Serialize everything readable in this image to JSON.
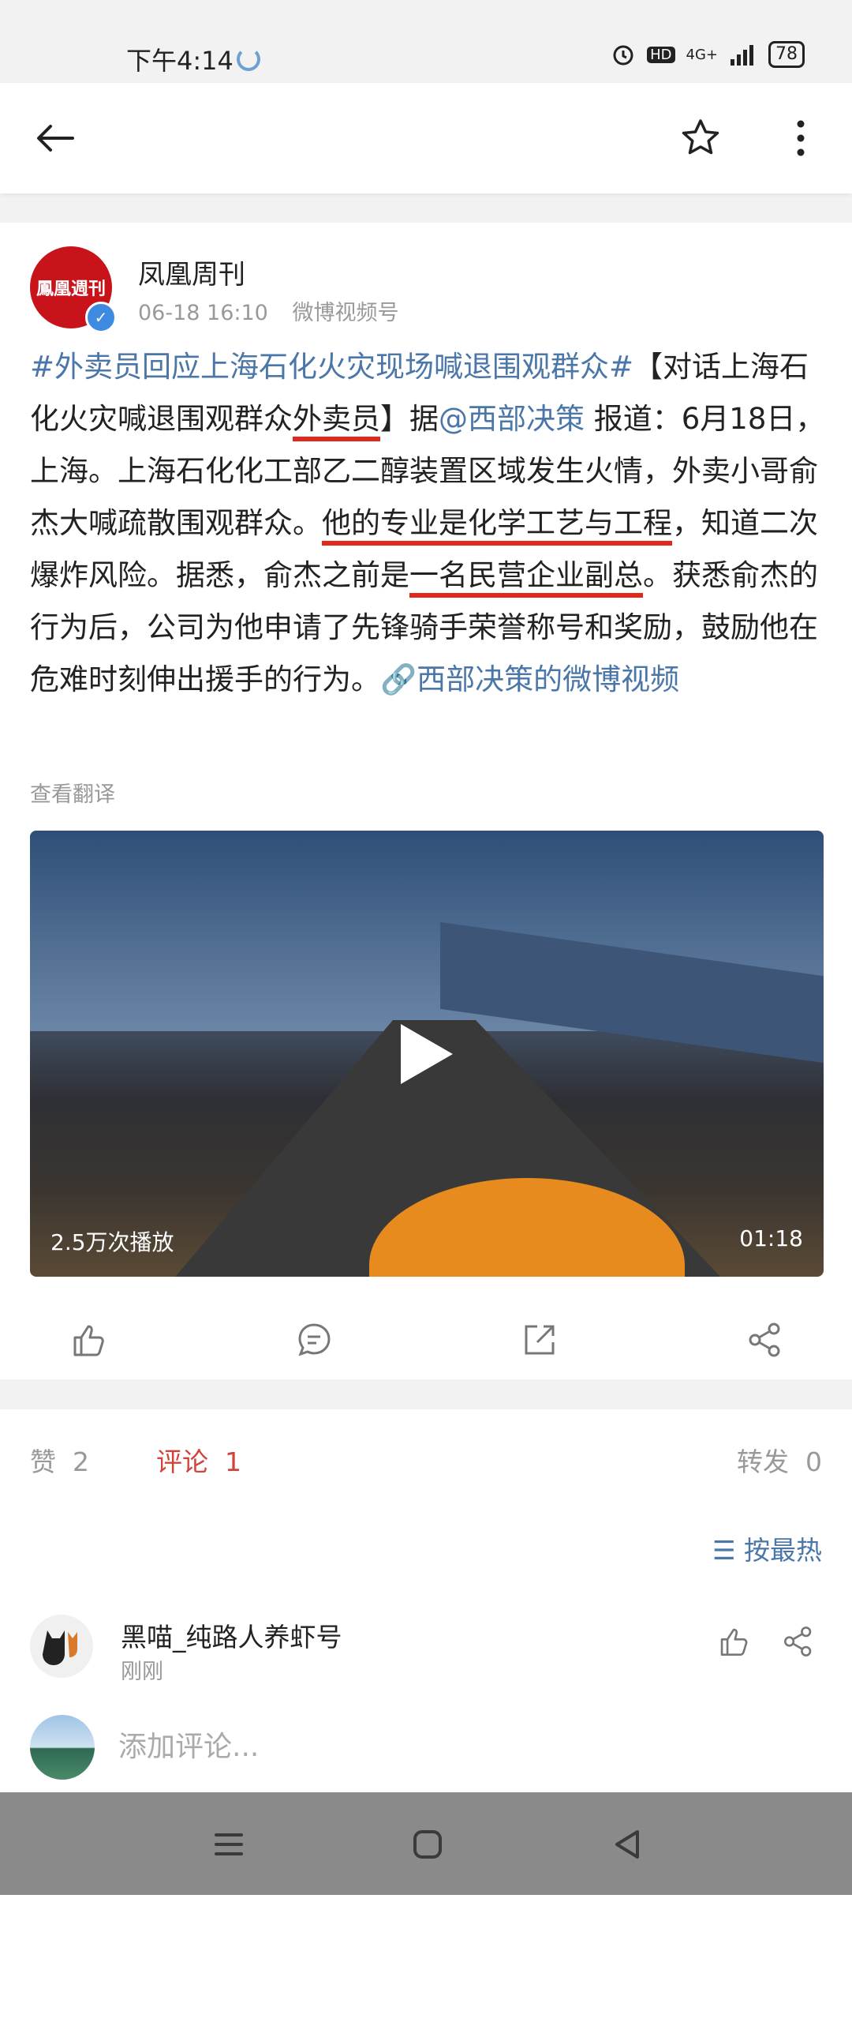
{
  "status_bar": {
    "time": "下午4:14",
    "network": "4G+",
    "hd": "HD",
    "battery": "78"
  },
  "header": {
    "back": "back",
    "star": "favorite",
    "more": "more"
  },
  "post": {
    "author": "凤凰周刊",
    "avatar_text": "鳳凰週刊",
    "timestamp": "06-18 16:10",
    "source": "微博视频号",
    "topic": "#外卖员回应上海石化火灾现场喊退围观群众#",
    "text_a": "【对话上海石化火灾喊退围观群众",
    "text_ul1": "外卖员",
    "text_b": "】据",
    "mention": "@西部决策",
    "text_c": " 报道：6月18日，上海。上海石化化工部乙二醇装置区域发生火情，外卖小哥俞杰大喊疏散围观群众。",
    "text_ul2": "他的专业是化学工艺与工程",
    "text_d": "，知道二次爆炸风险。据悉，俞杰之前是",
    "text_ul3": "一名民营企业副总",
    "text_e": "。获悉俞杰的行为后，公司为他申请了先锋骑手荣誉称号和奖励，鼓励他在危难时刻伸出援手的行为。",
    "video_link": "西部决策的微博视频",
    "translate": "查看翻译",
    "video": {
      "plays": "2.5万次播放",
      "duration": "01:18"
    }
  },
  "stats": {
    "likes_label": "赞",
    "likes": "2",
    "comments_label": "评论",
    "comments": "1",
    "shares_label": "转发",
    "shares": "0",
    "sort": "按最热"
  },
  "comment": {
    "name": "黑喵_纯路人养虾号",
    "time": "刚刚"
  },
  "comment_input": {
    "placeholder": "添加评论..."
  },
  "colors": {
    "link": "#4a76a8",
    "accent": "#d0443a",
    "underline": "#e0281c",
    "brand": "#c8131b"
  }
}
